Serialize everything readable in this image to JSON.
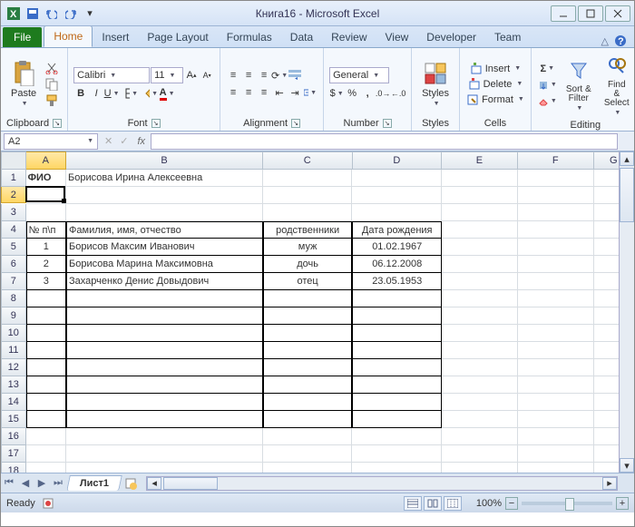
{
  "window": {
    "app_title": "Книга16 - Microsoft Excel"
  },
  "tabs": {
    "file": "File",
    "list": [
      "Home",
      "Insert",
      "Page Layout",
      "Formulas",
      "Data",
      "Review",
      "View",
      "Developer",
      "Team"
    ],
    "active": "Home"
  },
  "ribbon": {
    "clipboard": {
      "label": "Clipboard",
      "paste": "Paste"
    },
    "font": {
      "label": "Font",
      "name": "Calibri",
      "size": "11"
    },
    "alignment": {
      "label": "Alignment"
    },
    "number": {
      "label": "Number",
      "format": "General"
    },
    "styles": {
      "label": "Styles",
      "btn": "Styles"
    },
    "cells": {
      "label": "Cells",
      "insert": "Insert",
      "delete": "Delete",
      "format": "Format"
    },
    "editing": {
      "label": "Editing",
      "sort": "Sort & Filter",
      "find": "Find & Select"
    }
  },
  "namebox": "A2",
  "formula": "",
  "cols": {
    "A": 45,
    "B": 220,
    "C": 100,
    "D": 100,
    "E": 85,
    "F": 85,
    "G": 45
  },
  "grid": {
    "a1": "ФИО",
    "b1": "Борисова Ирина Алексеевна",
    "a4": "№ п\\п",
    "b4": "Фамилия, имя, отчество",
    "c4": "родственники",
    "d4": "Дата рождения",
    "a5": "1",
    "b5": "Борисов Максим Иванович",
    "c5": "муж",
    "d5": "01.02.1967",
    "a6": "2",
    "b6": "Борисова Марина Максимовна",
    "c6": "дочь",
    "d6": "06.12.2008",
    "a7": "3",
    "b7": "Захарченко Денис Довыдович",
    "c7": "отец",
    "d7": "23.05.1953"
  },
  "sheet_tab": "Лист1",
  "status": {
    "ready": "Ready",
    "zoom": "100%"
  }
}
